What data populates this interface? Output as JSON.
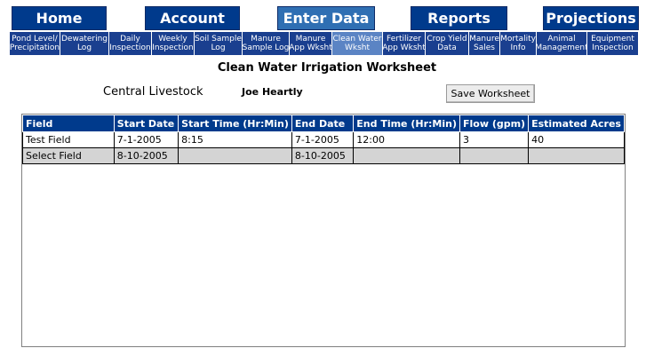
{
  "main_nav": [
    "Home",
    "Account",
    "Enter Data",
    "Reports",
    "Projections"
  ],
  "sub_nav": [
    [
      "Pond Level/",
      "Precipitation"
    ],
    [
      "Dewatering",
      "Log"
    ],
    [
      "Daily",
      "Inspection"
    ],
    [
      "Weekly",
      "Inspection"
    ],
    [
      "Soil Sample",
      "Log"
    ],
    [
      "Manure",
      "Sample Log"
    ],
    [
      "Manure",
      "App Wksht"
    ],
    [
      "Clean Water",
      "Wksht"
    ],
    [
      "Fertilizer",
      "App Wksht"
    ],
    [
      "Crop Yield",
      "Data"
    ],
    [
      "Manure",
      "Sales"
    ],
    [
      "Mortality",
      "Info"
    ],
    [
      "Animal",
      "Management"
    ],
    [
      "Equipment",
      "Inspection"
    ]
  ],
  "page": {
    "title": "Clean Water Irrigation Worksheet",
    "farm": "Central Livestock",
    "owner": "Joe Heartly",
    "save_label": "Save Worksheet"
  },
  "grid": {
    "columns": [
      "Field",
      "Start Date",
      "Start Time (Hr:Min)",
      "End Date",
      "End Time (Hr:Min)",
      "Flow (gpm)",
      "Estimated Acres"
    ],
    "rows": [
      [
        "Test Field",
        "7-1-2005",
        "8:15",
        "7-1-2005",
        "12:00",
        "3",
        "40"
      ],
      [
        "Select Field",
        "8-10-2005",
        "",
        "8-10-2005",
        "",
        "",
        ""
      ]
    ]
  },
  "colors": {
    "nav_blue": "#003a8c",
    "nav_active": "#2f6fb3",
    "subnav_blue": "#1a3f8f",
    "row_alt": "#d4d4d4"
  }
}
